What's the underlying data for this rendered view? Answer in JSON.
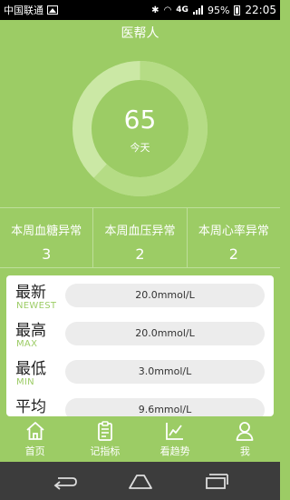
{
  "status_bar": {
    "carrier": "中国联通",
    "network": "4G",
    "battery": "95%",
    "time": "22:05"
  },
  "title": "医帮人",
  "ring": {
    "value": "65",
    "label": "今天",
    "fill_fraction": 0.62,
    "colors": {
      "track": "#cbe8a5",
      "progress": "#b5dc85",
      "center": "#9ccc65"
    }
  },
  "stats": [
    {
      "title": "本周血糖异常",
      "value": "3"
    },
    {
      "title": "本周血压异常",
      "value": "2"
    },
    {
      "title": "本周心率异常",
      "value": "2"
    }
  ],
  "readings": [
    {
      "cn": "最新",
      "en": "NEWEST",
      "value": "20.0mmol/L"
    },
    {
      "cn": "最高",
      "en": "MAX",
      "value": "20.0mmol/L"
    },
    {
      "cn": "最低",
      "en": "MIN",
      "value": "3.0mmol/L"
    },
    {
      "cn": "平均",
      "en": "",
      "value": "9.6mmol/L"
    }
  ],
  "tabs": [
    {
      "label": "首页",
      "icon": "home-icon"
    },
    {
      "label": "记指标",
      "icon": "clipboard-icon"
    },
    {
      "label": "看趋势",
      "icon": "trend-chart-icon"
    },
    {
      "label": "我",
      "icon": "person-icon"
    }
  ],
  "colors": {
    "accent": "#9ccc65",
    "nav_bg": "#3c3c3c",
    "status_bg": "#000000"
  }
}
